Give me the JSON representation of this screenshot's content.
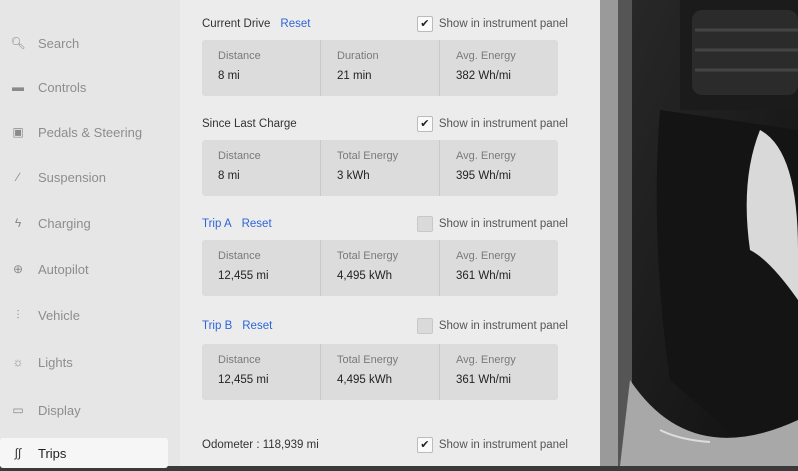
{
  "sidebar": {
    "items": [
      {
        "label": "Search",
        "icon": "search-icon",
        "active": false
      },
      {
        "label": "Controls",
        "icon": "toggle-icon",
        "active": false
      },
      {
        "label": "Pedals & Steering",
        "icon": "car-icon",
        "active": false
      },
      {
        "label": "Suspension",
        "icon": "wrench-icon",
        "active": false
      },
      {
        "label": "Charging",
        "icon": "lightning-icon",
        "active": false
      },
      {
        "label": "Autopilot",
        "icon": "steering-wheel-icon",
        "active": false
      },
      {
        "label": "Vehicle",
        "icon": "sliders-icon",
        "active": false
      },
      {
        "label": "Lights",
        "icon": "sun-icon",
        "active": false
      },
      {
        "label": "Display",
        "icon": "display-icon",
        "active": false
      },
      {
        "label": "Trips",
        "icon": "trips-icon",
        "active": true
      }
    ]
  },
  "sections": [
    {
      "title": "Current Drive",
      "title_blue": false,
      "reset_label": "Reset",
      "checkbox_label": "Show in instrument panel",
      "checked": true,
      "stats": [
        {
          "label": "Distance",
          "value": "8 mi"
        },
        {
          "label": "Duration",
          "value": "21 min"
        },
        {
          "label": "Avg. Energy",
          "value": "382 Wh/mi"
        }
      ]
    },
    {
      "title": "Since Last Charge",
      "title_blue": false,
      "reset_label": "",
      "checkbox_label": "Show in instrument panel",
      "checked": true,
      "stats": [
        {
          "label": "Distance",
          "value": "8 mi"
        },
        {
          "label": "Total Energy",
          "value": "3 kWh"
        },
        {
          "label": "Avg. Energy",
          "value": "395 Wh/mi"
        }
      ]
    },
    {
      "title": "Trip A",
      "title_blue": true,
      "reset_label": "Reset",
      "checkbox_label": "Show in instrument panel",
      "checked": false,
      "stats": [
        {
          "label": "Distance",
          "value": "12,455 mi"
        },
        {
          "label": "Total Energy",
          "value": "4,495 kWh"
        },
        {
          "label": "Avg. Energy",
          "value": "361 Wh/mi"
        }
      ]
    },
    {
      "title": "Trip B",
      "title_blue": true,
      "reset_label": "Reset",
      "checkbox_label": "Show in instrument panel",
      "checked": false,
      "stats": [
        {
          "label": "Distance",
          "value": "12,455 mi"
        },
        {
          "label": "Total Energy",
          "value": "4,495 kWh"
        },
        {
          "label": "Avg. Energy",
          "value": "361 Wh/mi"
        }
      ]
    }
  ],
  "odometer": {
    "label": "Odometer : 118,939 mi",
    "checkbox_label": "Show in instrument panel",
    "checked": true
  },
  "colors": {
    "accent": "#2e65d9"
  }
}
